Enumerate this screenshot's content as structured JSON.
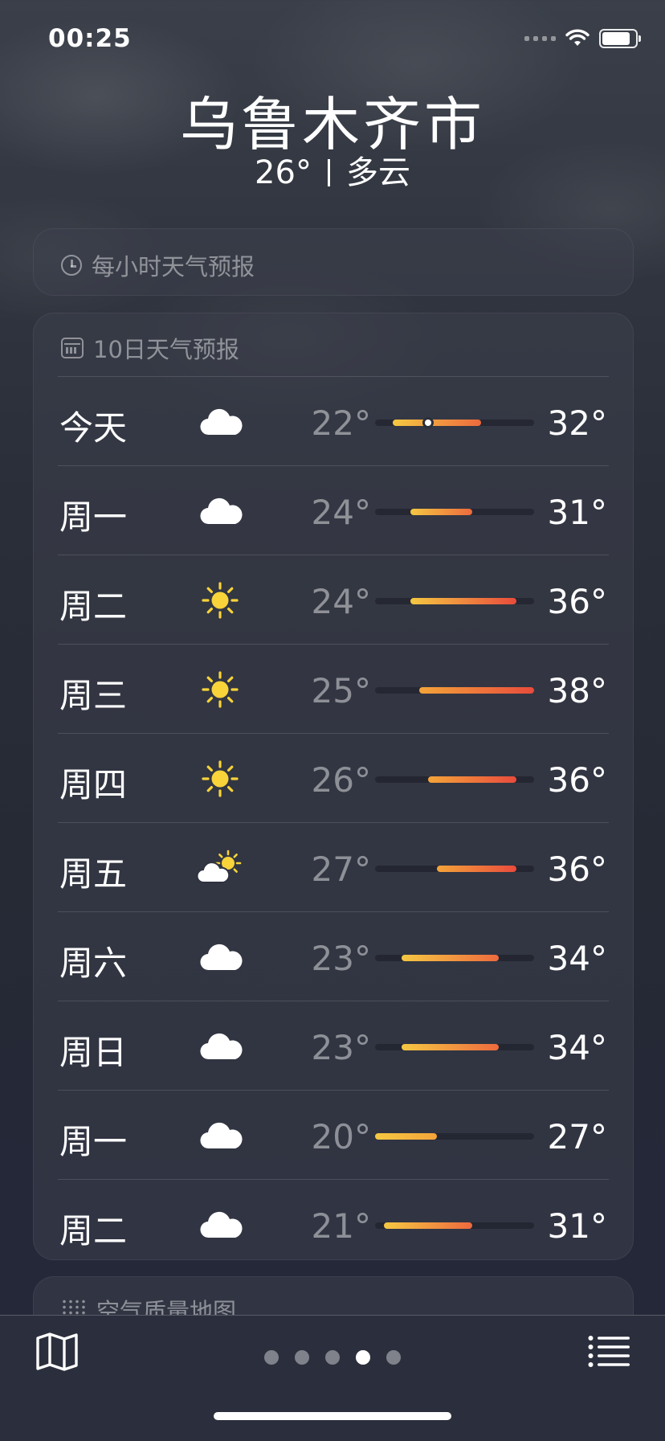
{
  "status_bar": {
    "time": "00:25"
  },
  "header": {
    "city": "乌鲁木齐市",
    "temp": "26°",
    "condition": "多云"
  },
  "hourly_card": {
    "title": "每小时天气预报"
  },
  "daily_card": {
    "title": "10日天气预报",
    "days": [
      {
        "day": "今天",
        "icon": "cloud",
        "low": "22°",
        "high": "32°"
      },
      {
        "day": "周一",
        "icon": "cloud",
        "low": "24°",
        "high": "31°"
      },
      {
        "day": "周二",
        "icon": "sun",
        "low": "24°",
        "high": "36°"
      },
      {
        "day": "周三",
        "icon": "sun",
        "low": "25°",
        "high": "38°"
      },
      {
        "day": "周四",
        "icon": "sun",
        "low": "26°",
        "high": "36°"
      },
      {
        "day": "周五",
        "icon": "partly-cloudy",
        "low": "27°",
        "high": "36°"
      },
      {
        "day": "周六",
        "icon": "cloud",
        "low": "23°",
        "high": "34°"
      },
      {
        "day": "周日",
        "icon": "cloud",
        "low": "23°",
        "high": "34°"
      },
      {
        "day": "周一",
        "icon": "cloud",
        "low": "20°",
        "high": "27°"
      },
      {
        "day": "周二",
        "icon": "cloud",
        "low": "21°",
        "high": "31°"
      }
    ],
    "current_temp_marker": 26,
    "range_min": 20,
    "range_max": 38
  },
  "air_card": {
    "title": "空气质量地图"
  },
  "bottom_bar": {
    "page_count": 5,
    "active_page": 3
  },
  "colors": {
    "cool": "#f5c842",
    "mid": "#f4a43a",
    "warm": "#ee6a3e",
    "hot": "#e94b3c"
  }
}
